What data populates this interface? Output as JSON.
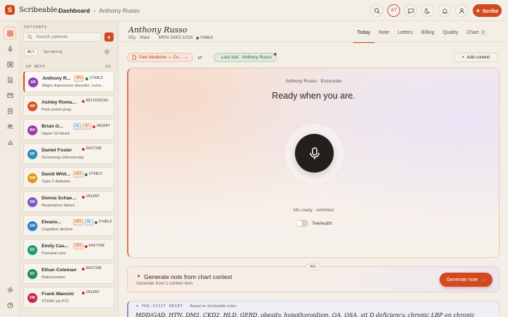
{
  "app": {
    "logo_letter": "S",
    "brand": "Scribeable."
  },
  "breadcrumb": {
    "root": "Dashboard",
    "separator": "›",
    "current": "Anthony Russo"
  },
  "topbar": {
    "queue_count": "2/7",
    "scribe_label": "Scribe"
  },
  "patients_panel": {
    "heading": "PATIENTS",
    "search_placeholder": "Search patients",
    "add_label": "+",
    "tabs": [
      "All",
      "Upcoming"
    ],
    "upnext_label": "UP NEXT",
    "upnext_count": "29",
    "patients": [
      {
        "initials": "AR",
        "name": "Anthony R...",
        "tags": [
          "NFU"
        ],
        "status": "STABLE",
        "status_color": "#3f7a48",
        "dx": "Major depressive disorder, curre...",
        "avatar_color": "#8e3fb0",
        "active": true
      },
      {
        "initials": "AR",
        "name": "Ashley Roma...",
        "tags": [],
        "status": "RECOVERING",
        "status_color": "#d2491f",
        "dx": "Post crown prep",
        "avatar_color": "#d6561f",
        "active": false
      },
      {
        "initials": "BO",
        "name": "Brian O...",
        "tags": [
          "AL",
          "RX"
        ],
        "status": "URGENT",
        "status_color": "#d2361f",
        "dx": "Upper GI bleed",
        "avatar_color": "#9a3aa6",
        "active": false
      },
      {
        "initials": "DF",
        "name": "Daniel Foster",
        "tags": [],
        "status": "ROUTINE",
        "status_color": "#d2361f",
        "dx": "Screening colonoscopy",
        "avatar_color": "#2e8fae",
        "active": false
      },
      {
        "initials": "DW",
        "name": "David Whit...",
        "tags": [
          "NFU"
        ],
        "status": "STABLE",
        "status_color": "#3f7a48",
        "dx": "Type 2 diabetes",
        "avatar_color": "#e09a18",
        "active": false
      },
      {
        "initials": "DS",
        "name": "Donna Schaefer",
        "tags": [],
        "status": "URGENT",
        "status_color": "#d2361f",
        "dx": "Respiratory failure",
        "avatar_color": "#7d5ac4",
        "active": false
      },
      {
        "initials": "EM",
        "name": "Eleano...",
        "tags": [
          "NFU",
          "AL"
        ],
        "status": "STABLE",
        "status_color": "#3f7a48",
        "dx": "Cognitive decline",
        "avatar_color": "#2b7fc4",
        "active": false
      },
      {
        "initials": "EC",
        "name": "Emily Cas...",
        "tags": [
          "NFU"
        ],
        "status": "ROUTINE",
        "status_color": "#d2361f",
        "dx": "Prenatal care",
        "avatar_color": "#1f9a6e",
        "active": false
      },
      {
        "initials": "EC",
        "name": "Ethan Coleman",
        "tags": [],
        "status": "ROUTINE",
        "status_color": "#d2361f",
        "dx": "Malocclusion",
        "avatar_color": "#1f8a5e",
        "active": false
      },
      {
        "initials": "FM",
        "name": "Frank Mancini",
        "tags": [],
        "status": "URGENT",
        "status_color": "#d2361f",
        "dx": "STEMI s/p PCI",
        "avatar_color": "#c42a4a",
        "active": false
      }
    ]
  },
  "patient_header": {
    "name": "Anthony Russo",
    "age_sex": "55y · Male",
    "mrn": "MRN DMO-1028",
    "status": "STABLE"
  },
  "tabs": [
    {
      "label": "Today",
      "active": true
    },
    {
      "label": "Note",
      "active": false
    },
    {
      "label": "Letters",
      "active": false
    },
    {
      "label": "Billing",
      "active": false
    },
    {
      "label": "Quality",
      "active": false
    },
    {
      "label": "Chart",
      "active": false,
      "badge": "8"
    }
  ],
  "context_bar": {
    "template_chip": "Pain Medicine — Co...",
    "last_visit_chip": "Last visit · Anthony Russo",
    "add_context": "Add context"
  },
  "encounter": {
    "label": "Anthony Russo · Encounter",
    "title": "Ready when you are.",
    "mic_status": "Mic ready · unlimited",
    "telehealth_label": "Telehealth"
  },
  "generate": {
    "kbd": "⌘G",
    "title": "Generate note from chart context",
    "subtitle": "Generate from 1 context item",
    "button": "Generate note"
  },
  "brief": {
    "tag": "PRE-VISIT BRIEF",
    "source": "Based on Scribeable notes",
    "text": "MDD/GAD, HTN, DM2, CKD2, HLD, GERD, obesity, hypothyroidism, OA, OSA, vit D deficiency, chronic LBP on chronic opioids—continue current regimen, avoid PCN/sulfa."
  },
  "colors": {
    "accent": "#d2491f",
    "stable": "#3f7a48",
    "urgent": "#d2361f"
  }
}
